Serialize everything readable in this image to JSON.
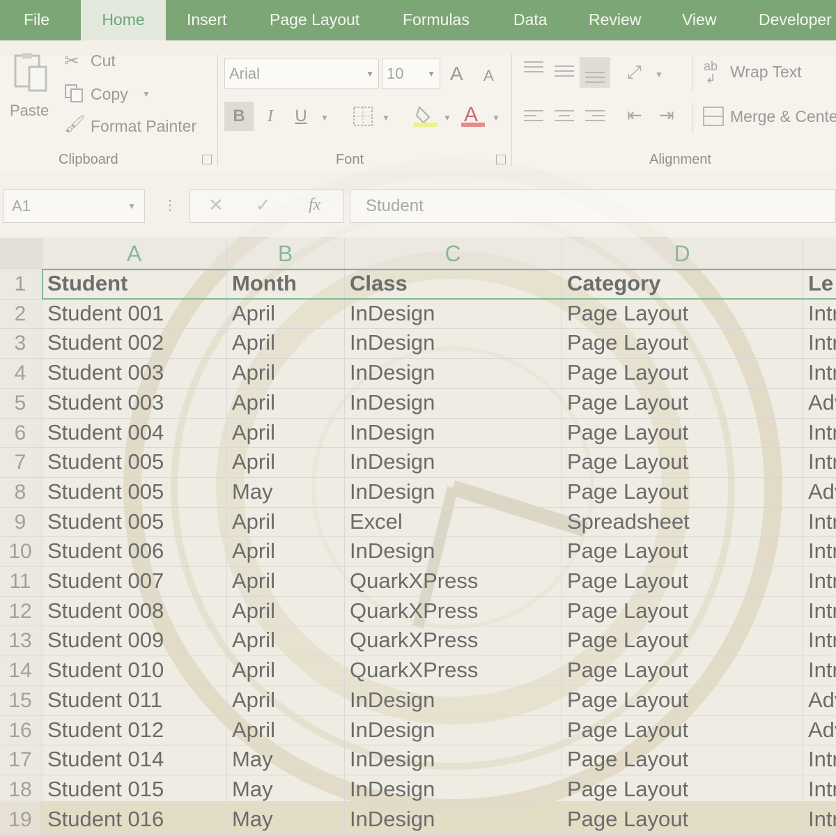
{
  "tabs": [
    "File",
    "Home",
    "Insert",
    "Page Layout",
    "Formulas",
    "Data",
    "Review",
    "View",
    "Developer"
  ],
  "clipboard": {
    "paste": "Paste",
    "cut": "Cut",
    "copy": "Copy",
    "format_painter": "Format Painter",
    "group_label": "Clipboard"
  },
  "font": {
    "name": "Arial",
    "size": "10",
    "bold": "B",
    "italic": "I",
    "underline": "U",
    "font_color_glyph": "A",
    "grow_glyph": "A",
    "shrink_glyph": "A",
    "group_label": "Font"
  },
  "alignment": {
    "wrap_text": "Wrap Text",
    "merge_center": "Merge & Center",
    "group_label": "Alignment"
  },
  "formula_bar": {
    "name_box": "A1",
    "fx": "fx",
    "formula": "Student"
  },
  "sheet": {
    "columns": [
      "A",
      "B",
      "C",
      "D"
    ],
    "row_numbers": [
      "1",
      "2",
      "3",
      "4",
      "5",
      "6",
      "7",
      "8",
      "9",
      "10",
      "11",
      "12",
      "13",
      "14",
      "15",
      "16",
      "17",
      "18",
      "19"
    ],
    "header": [
      "Student",
      "Month",
      "Class",
      "Category",
      "Le"
    ],
    "rows": [
      [
        "Student  001",
        "April",
        "InDesign",
        "Page Layout",
        "Intr"
      ],
      [
        "Student  002",
        "April",
        "InDesign",
        "Page Layout",
        "Intr"
      ],
      [
        "Student  003",
        "April",
        "InDesign",
        "Page Layout",
        "Intr"
      ],
      [
        "Student  003",
        "April",
        "InDesign",
        "Page Layout",
        "Adv"
      ],
      [
        "Student  004",
        "April",
        "InDesign",
        "Page Layout",
        "Intr"
      ],
      [
        "Student  005",
        "April",
        "InDesign",
        "Page Layout",
        "Intr"
      ],
      [
        "Student  005",
        "May",
        "InDesign",
        "Page Layout",
        "Adv"
      ],
      [
        "Student  005",
        "April",
        "Excel",
        "Spreadsheet",
        "Intr"
      ],
      [
        "Student  006",
        "April",
        "InDesign",
        "Page Layout",
        "Intr"
      ],
      [
        "Student  007",
        "April",
        "QuarkXPress",
        "Page Layout",
        "Intr"
      ],
      [
        "Student  008",
        "April",
        "QuarkXPress",
        "Page Layout",
        "Intr"
      ],
      [
        "Student  009",
        "April",
        "QuarkXPress",
        "Page Layout",
        "Intr"
      ],
      [
        "Student  010",
        "April",
        "QuarkXPress",
        "Page Layout",
        "Intr"
      ],
      [
        "Student  011",
        "April",
        "InDesign",
        "Page Layout",
        "Adv"
      ],
      [
        "Student  012",
        "April",
        "InDesign",
        "Page Layout",
        "Adv"
      ],
      [
        "Student  014",
        "May",
        "InDesign",
        "Page Layout",
        "Intr"
      ],
      [
        "Student  015",
        "May",
        "InDesign",
        "Page Layout",
        "Intr"
      ],
      [
        "Student  016",
        "May",
        "InDesign",
        "Page Layout",
        "Intr"
      ]
    ]
  }
}
